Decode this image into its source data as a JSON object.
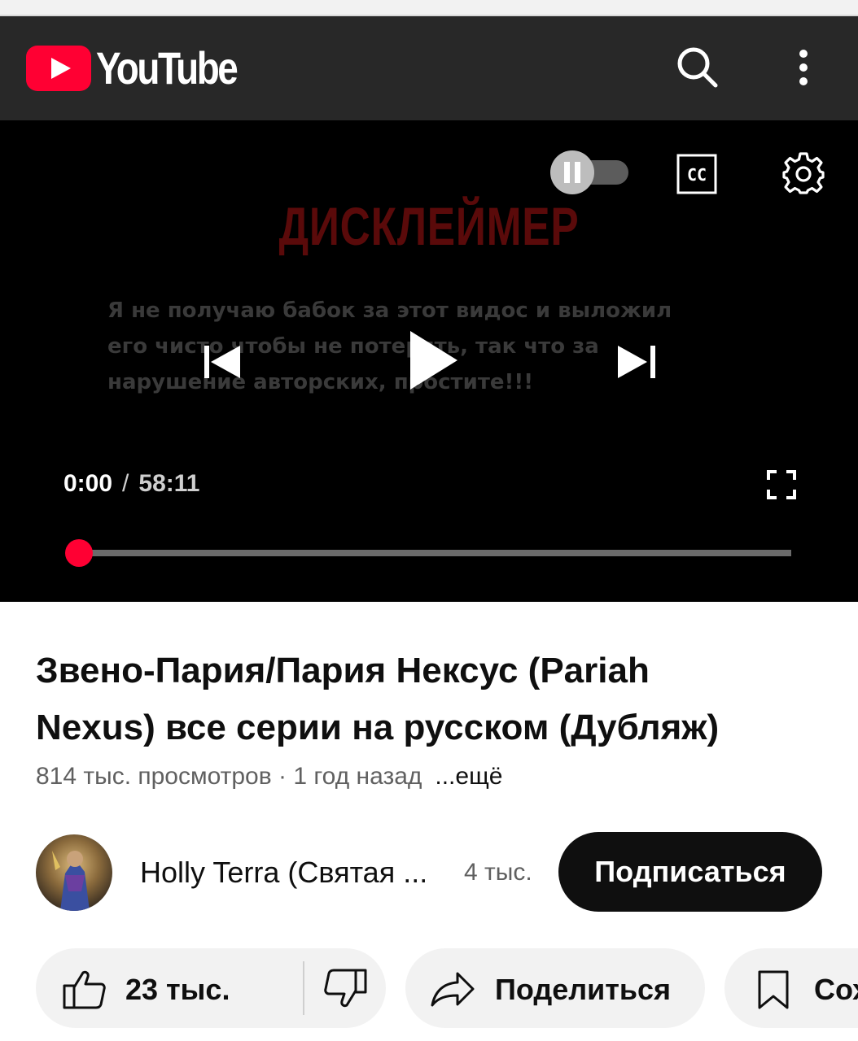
{
  "app": {
    "logo_text": "YouTube",
    "header_icons": [
      "search-icon",
      "more-vertical-icon"
    ]
  },
  "player": {
    "overlay_title": "ДИСКЛЕЙМЕР",
    "overlay_lines": [
      "Я не получаю бабок за этот видос и выложил",
      "его чисто чтобы не потерять, так что за",
      "нарушение авторских, простите!!!"
    ],
    "current_time": "0:00",
    "time_separator": "/",
    "duration": "58:11",
    "progress_fraction": 0.0,
    "autoplay_on": true,
    "controls": [
      "previous-icon",
      "play-icon",
      "next-icon",
      "cc-icon",
      "settings-icon",
      "fullscreen-icon"
    ],
    "cc_label": "CC",
    "accent_color": "#ff0033"
  },
  "video": {
    "title_line1": "Звено-Пария/Пария Нексус (Pariah",
    "title_line2": "Nexus) все серии на русском (Дубляж)",
    "views": "814 тыс. просмотров",
    "meta_sep": " · ",
    "uploaded": "1 год назад",
    "more_label": "...ещё"
  },
  "channel": {
    "name": "Holly Terra (Святая ...",
    "subscribers": "4 тыс.",
    "subscribe_label": "Подписаться"
  },
  "actions": {
    "likes": "23 тыс.",
    "share_label": "Поделиться",
    "save_label": "Сох"
  }
}
